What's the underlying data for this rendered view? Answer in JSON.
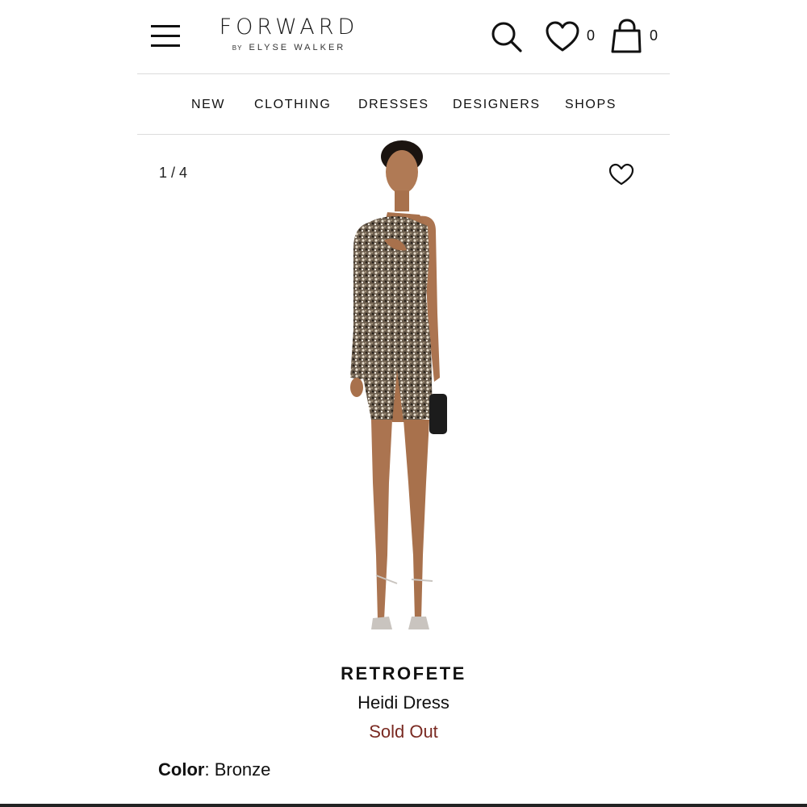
{
  "header": {
    "logo_main": "FORWARD",
    "logo_by": "BY",
    "logo_sub": "ELYSE WALKER",
    "wishlist_count": "0",
    "bag_count": "0"
  },
  "nav": {
    "items": [
      "NEW",
      "CLOTHING",
      "DRESSES",
      "DESIGNERS",
      "SHOPS"
    ]
  },
  "gallery": {
    "counter": "1 / 4"
  },
  "product": {
    "brand": "RETROFETE",
    "name": "Heidi Dress",
    "status": "Sold Out",
    "color_label": "Color",
    "color_value": "Bronze"
  },
  "colors": {
    "status": "#7a2a22",
    "divider": "#dcdcdc",
    "text": "#111111"
  },
  "icons": [
    "hamburger-menu-icon",
    "search-icon",
    "heart-icon",
    "shopping-bag-icon"
  ]
}
